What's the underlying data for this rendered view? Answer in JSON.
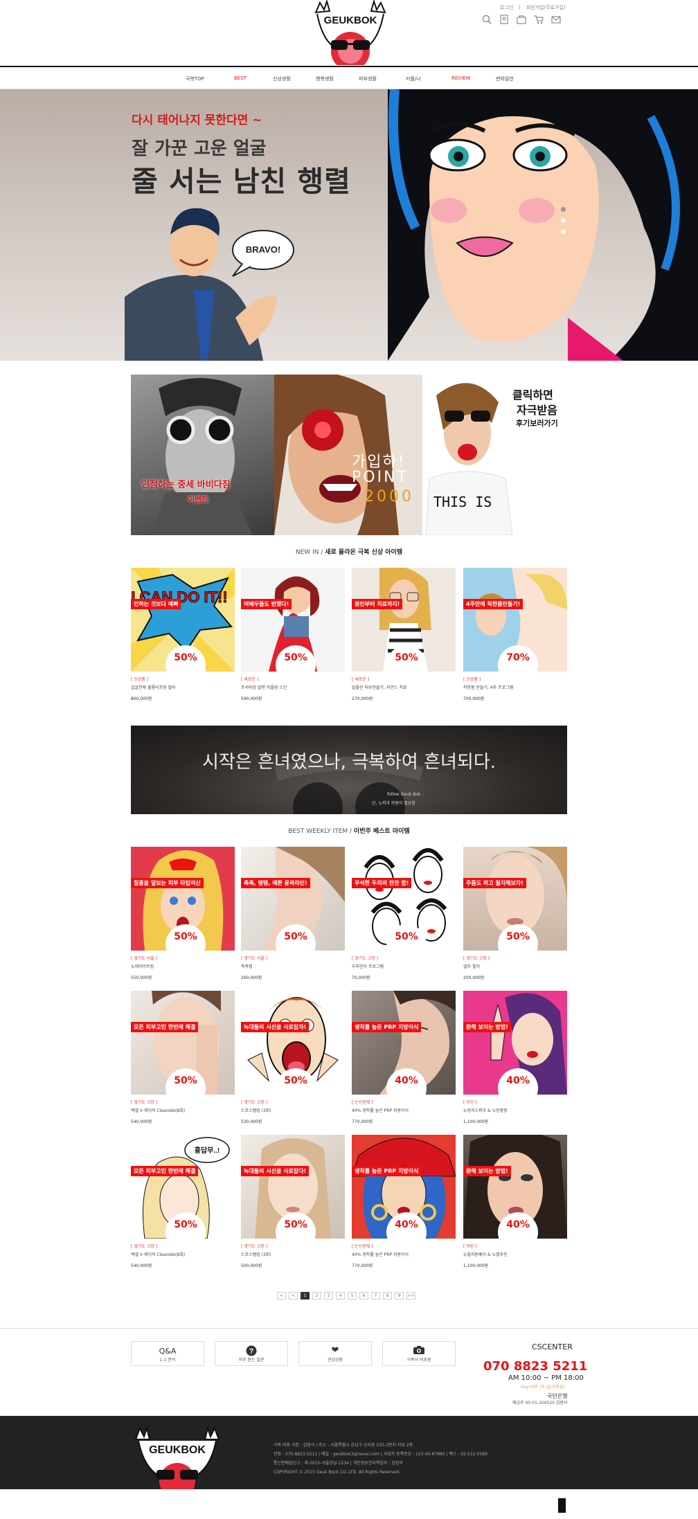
{
  "header": {
    "logo_text": "GEUKBOK",
    "util_links": [
      "로그인",
      "회원가입(무료가입)"
    ],
    "icons": [
      "search-icon",
      "user-icon",
      "bag-icon",
      "cart-icon",
      "mail-icon"
    ]
  },
  "gnb": {
    "items": [
      "극복TOP",
      "BEST",
      "신상생활",
      "행복생활",
      "피부생활",
      "커플/나",
      "REVIEW",
      "변화일언"
    ]
  },
  "hero": {
    "line1": "다시 태어나지 못한다면 ~",
    "line2": "잘 가꾼 고운 얼굴",
    "line3": "줄 서는 남친 행렬",
    "bubble": "BRAVO!"
  },
  "promos": {
    "p1_text": "인정하는 중세 바비다짐",
    "p1_sub": "이벤트",
    "p2_line1": "가입하!",
    "p2_line2": "POINT",
    "p2_line3": "2000",
    "p3_line1": "클릭하면",
    "p3_line2": "자극받음",
    "p3_line3": "후기보러가기",
    "p3_shirt": "THIS IS"
  },
  "newin": {
    "title_en": "NEW IN",
    "title_ko": "새로 올라온 극복 신상 아이템",
    "items": [
      {
        "tag": "인하는 것보다 예뻐",
        "disc": "50%",
        "cat": "[ 신상품 ]",
        "name": "얼굴전체 볼륨리프팅 필러",
        "price": "860,000원",
        "art_text": "I CAN DO IT!!"
      },
      {
        "tag": "여배우들도 반했다!",
        "disc": "50%",
        "cat": "[ 새로운 ]",
        "name": "프리미엄 발편 커플링 스킨",
        "price": "590,000원"
      },
      {
        "tag": "원인부터 치료까지!",
        "disc": "50%",
        "cat": "[ 새로운 ]",
        "name": "탈출진 피부만들기, 자연스 치료",
        "price": "270,000원"
      },
      {
        "tag": "4주만에 착한몸만들기!",
        "disc": "70%",
        "cat": "[ 신상품 ]",
        "name": "착한몸 만들기, 4주 프로그램",
        "price": "700,000원"
      }
    ]
  },
  "midbanner": {
    "text": "시작은 흔녀였으나, 극복하여 흔녀되다.",
    "sub1": "follow Geuk Bok..",
    "sub2": "단, 노력과 자몽이 필요함"
  },
  "best": {
    "title_en": "BEST WEEKLY ITEM",
    "title_ko": "이번주 베스트 아이템",
    "items": [
      {
        "tag": "칠흉을 덮보는 피부 타입여신",
        "disc": "50%",
        "cat": "[ 경기도 서울 ]",
        "name": "뉴레라이트링",
        "price": "550,000원"
      },
      {
        "tag": "촉촉, 탱탱, 예쁜 윤곽라인!",
        "disc": "50%",
        "cat": "[ 경기도 서울 ]",
        "name": "촉촉랩",
        "price": "260,000원"
      },
      {
        "tag": "무석한 두피의 찬찬 팝!",
        "disc": "50%",
        "cat": "[ 경기도 고양 ]",
        "name": "두피관리 프로그램",
        "price": "70,000원"
      },
      {
        "tag": "주름도 펴고 젊지해보자!",
        "disc": "50%",
        "cat": "[ 경기도 고양 ]",
        "name": "엘지 필러",
        "price": "200,000원"
      },
      {
        "tag": "모든 피부고민 한번에 해결",
        "disc": "50%",
        "cat": "[ 경기도 고양 ]",
        "name": "엑셀 V 레이저 Clearode(8회)",
        "price": "540,000원"
      },
      {
        "tag": "녹대들의 시선을 사로잡자!",
        "disc": "50%",
        "cat": "[ 경기도 고양 ]",
        "name": "드로스템업 (3회)",
        "price": "530,000원"
      },
      {
        "tag": "생착률 높은 PRP 지방이식",
        "disc": "40%",
        "cat": "[ 논산문제 ]",
        "name": "40% 생착률 높은 PRP 지방이식",
        "price": "770,000원"
      },
      {
        "tag": "환해 보이는 방법!",
        "disc": "40%",
        "cat": "[ 부산 ]",
        "name": "뉴방지스피부 & 뉴방광증",
        "price": "1,100,000원"
      },
      {
        "tag": "모든 피부고민 한번에 해결",
        "disc": "50%",
        "cat": "[ 경기도 고양 ]",
        "name": "엑셀 V 레이저 Clearode(8회)",
        "price": "540,000원",
        "bubble": "흥답무..!"
      },
      {
        "tag": "녹대들의 시선을 사로잡다!",
        "disc": "50%",
        "cat": "[ 경기도 고양 ]",
        "name": "드로스템업 (3회)",
        "price": "500,000원"
      },
      {
        "tag": "생착률 높은 PRP 지방이식",
        "disc": "40%",
        "cat": "[ 논산문제 ]",
        "name": "40% 생착률 높은 PRP 지방이식",
        "price": "770,000원"
      },
      {
        "tag": "환해 보이는 방법!",
        "disc": "40%",
        "cat": "[ 의원 ]",
        "name": "뉴발리원페이 & 뉴랩주진",
        "price": "1,100,000원"
      }
    ]
  },
  "pager": {
    "prev": "<",
    "pages": [
      "1",
      "2",
      "3",
      "4",
      "5",
      "6",
      "7",
      "8",
      "9"
    ],
    "current": "1",
    "next": ">>"
  },
  "cs": {
    "boxes": [
      {
        "icon": "qa-icon",
        "label": "1:1 문의",
        "top": "Q&A"
      },
      {
        "icon": "question-icon",
        "label": "자주 묻는 질문",
        "top": "?"
      },
      {
        "icon": "heart-icon",
        "label": "관심상품",
        "top": "❤"
      },
      {
        "icon": "camera-icon",
        "label": "극복녀 비포원",
        "top": "📷"
      }
    ],
    "title": "CSCENTER",
    "phone": "070 8823 5211",
    "hours": "AM 10:00 ~ PM 18:00",
    "off": "Day OFF (토,일/공휴일)",
    "bank": "국민은행",
    "account": "예금주 00-01-200520 김범석"
  },
  "footer": {
    "lines": [
      "극복 미용 극장 : 김범석    |    주소 : 서울특별시 강남구 신사동 535-3번지 지상 2층",
      "전화 : 070-8823-5211    |    메일 : geukbok3@naver.com    |    사업자 등록번호 : 123-45-67890    |    팩스 : 02-512-5589",
      "통신판매업신고 : 제 2015-서울강남-1234    |    개인정보관리책임자 : 김범석",
      "COPYRIGHT © 2015 Geuk Bock CO.,LTD. All Rights Reserved."
    ]
  },
  "colors": {
    "accent": "#e11111",
    "dark": "#222222",
    "hero_bg": "#c8beb7"
  }
}
